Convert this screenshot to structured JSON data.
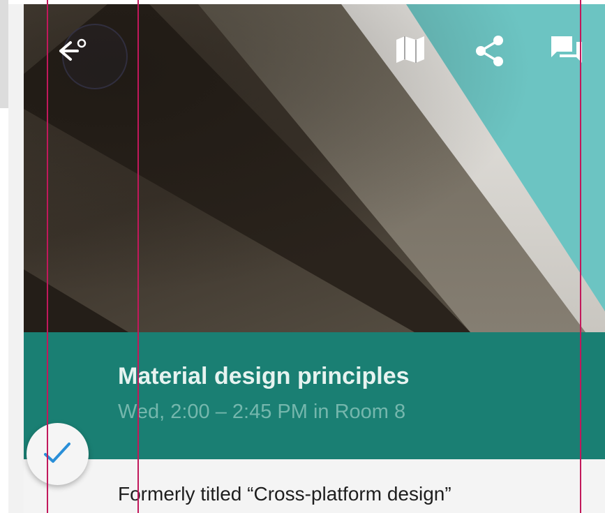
{
  "toolbar": {
    "back_icon": "back-arrow-icon",
    "actions": [
      "map-icon",
      "share-icon",
      "chat-icon"
    ]
  },
  "session": {
    "title": "Material design principles",
    "schedule": "Wed, 2:00 – 2:45 PM in Room 8",
    "description": "Formerly titled “Cross-platform design”"
  },
  "fab": {
    "icon": "checkmark-icon",
    "state": "added to schedule"
  },
  "colors": {
    "title_background": "#1a7f73",
    "title_text": "#e6f3f0",
    "schedule_text": "#75b7ad",
    "fab_check": "#2a8fd8",
    "keyline": "#c2185b"
  }
}
